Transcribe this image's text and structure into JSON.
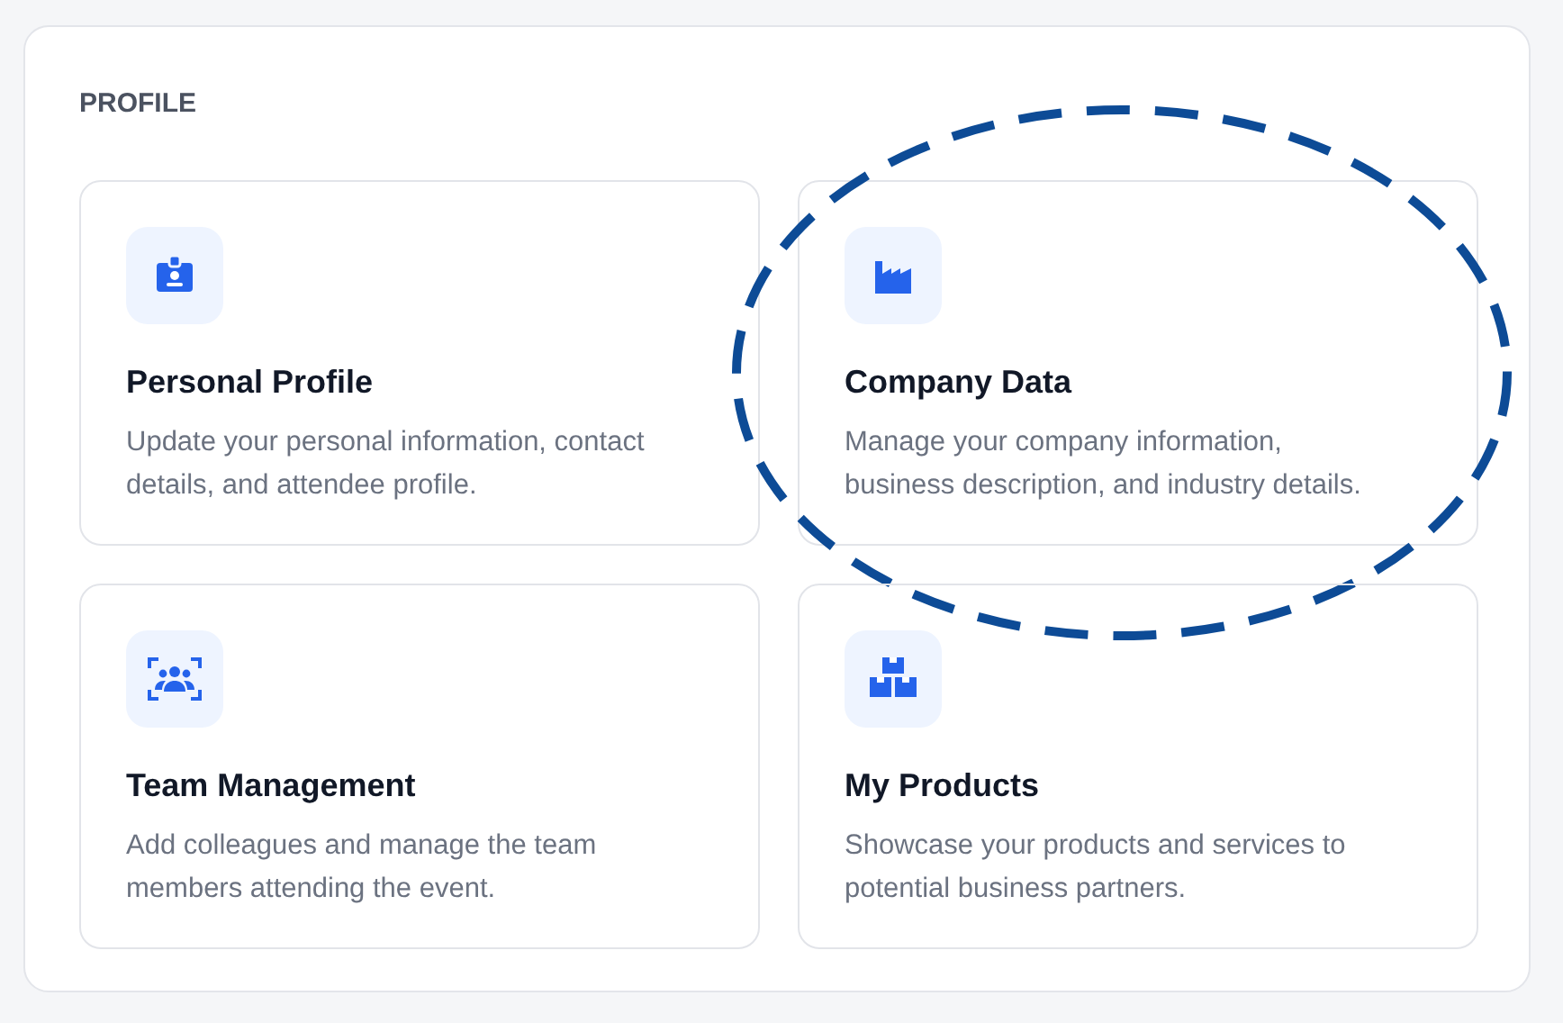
{
  "section": {
    "title": "PROFILE"
  },
  "cards": [
    {
      "kind": "badge",
      "title": "Personal Profile",
      "description": "Update your personal information, contact details, and attendee profile.",
      "highlighted": false
    },
    {
      "kind": "factory",
      "title": "Company Data",
      "description": "Manage your company information, business description, and industry details.",
      "highlighted": true
    },
    {
      "kind": "team",
      "title": "Team Management",
      "description": "Add colleagues and manage the team members attending the event.",
      "highlighted": false
    },
    {
      "kind": "boxes",
      "title": "My Products",
      "description": "Showcase your products and services to potential business partners.",
      "highlighted": false
    }
  ]
}
